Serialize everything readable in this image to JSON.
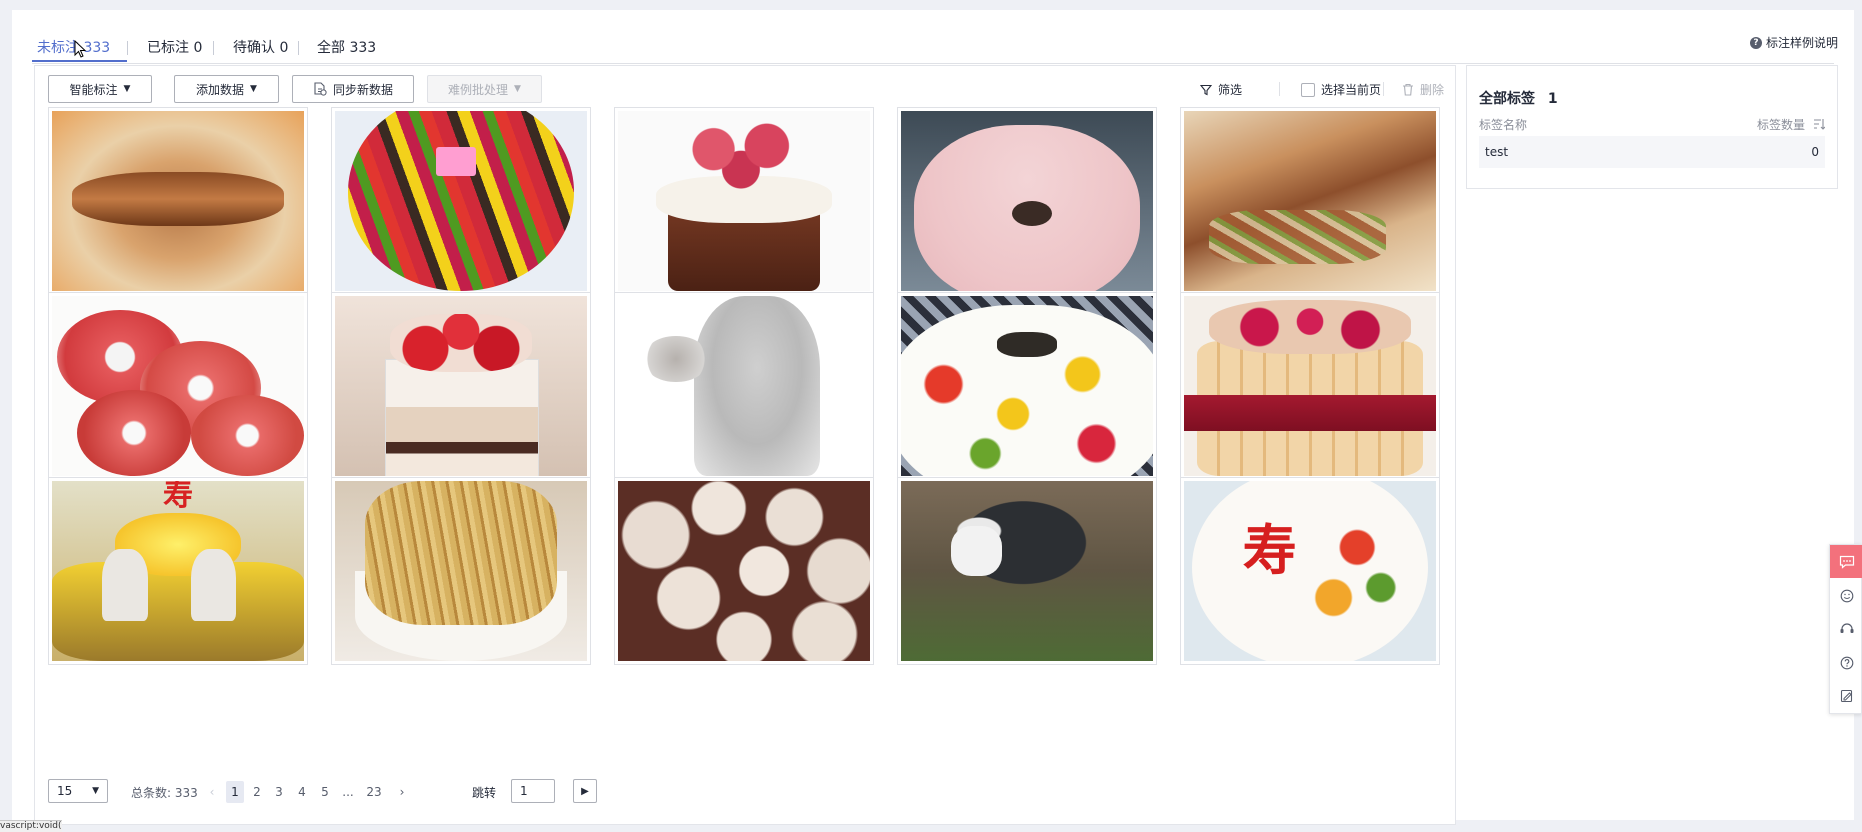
{
  "tabs": [
    {
      "label": "未标注 333",
      "active": true
    },
    {
      "label": "已标注 0",
      "active": false
    },
    {
      "label": "待确认 0",
      "active": false
    },
    {
      "label": "全部 333",
      "active": false
    }
  ],
  "help_link": "标注样例说明",
  "toolbar": {
    "smart_label": "智能标注",
    "add_data": "添加数据",
    "sync_data": "同步新数据",
    "hard_case": "难例批处理",
    "filter": "筛选",
    "select_page": "选择当前页",
    "delete": "删除"
  },
  "images": [
    {
      "name": "roujiamo"
    },
    {
      "name": "fruit-cake"
    },
    {
      "name": "raspberry-cupcake"
    },
    {
      "name": "pink-cake"
    },
    {
      "name": "roujiamo-2"
    },
    {
      "name": "red-donuts"
    },
    {
      "name": "strawberry-dessert-cup"
    },
    {
      "name": "kitten"
    },
    {
      "name": "fruit-cream-cake"
    },
    {
      "name": "raspberry-charlotte"
    },
    {
      "name": "birthday-cake-figures"
    },
    {
      "name": "noodles"
    },
    {
      "name": "soup-dumplings"
    },
    {
      "name": "dog"
    },
    {
      "name": "longevity-cake"
    }
  ],
  "pagination": {
    "page_size": "15",
    "total": "总条数: 333",
    "pages": [
      "1",
      "2",
      "3",
      "4",
      "5",
      "...",
      "23"
    ],
    "current_page": "1",
    "jump_label": "跳转",
    "jump_value": "1"
  },
  "label_panel": {
    "title": "全部标签",
    "count": "1",
    "col_name": "标签名称",
    "col_count": "标签数量",
    "rows": [
      {
        "name": "test",
        "count": "0"
      }
    ]
  },
  "status_bar": "vascript:void(0)",
  "colors": {
    "accent": "#526ecc",
    "feedback": "#f3717c"
  }
}
